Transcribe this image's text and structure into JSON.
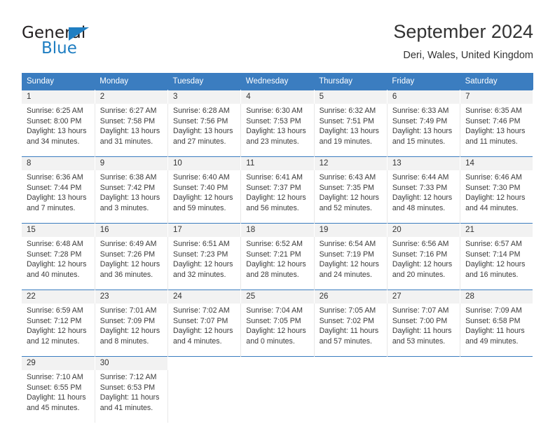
{
  "logo": {
    "word1": "General",
    "word2": "Blue",
    "triangle_color": "#1f7ec2",
    "text_color": "#231f20"
  },
  "header": {
    "title": "September 2024",
    "subtitle": "Deri, Wales, United Kingdom"
  },
  "theme": {
    "header_blue": "#3b7dc0",
    "daynum_band": "#f2f2f2",
    "text": "#333333"
  },
  "calendar": {
    "weekday_headers": [
      "Sunday",
      "Monday",
      "Tuesday",
      "Wednesday",
      "Thursday",
      "Friday",
      "Saturday"
    ],
    "labels": {
      "sunrise": "Sunrise:",
      "sunset": "Sunset:",
      "daylight": "Daylight:"
    },
    "weeks": [
      [
        {
          "day": "1",
          "sunrise": "Sunrise: 6:25 AM",
          "sunset": "Sunset: 8:00 PM",
          "daylight": "Daylight: 13 hours and 34 minutes."
        },
        {
          "day": "2",
          "sunrise": "Sunrise: 6:27 AM",
          "sunset": "Sunset: 7:58 PM",
          "daylight": "Daylight: 13 hours and 31 minutes."
        },
        {
          "day": "3",
          "sunrise": "Sunrise: 6:28 AM",
          "sunset": "Sunset: 7:56 PM",
          "daylight": "Daylight: 13 hours and 27 minutes."
        },
        {
          "day": "4",
          "sunrise": "Sunrise: 6:30 AM",
          "sunset": "Sunset: 7:53 PM",
          "daylight": "Daylight: 13 hours and 23 minutes."
        },
        {
          "day": "5",
          "sunrise": "Sunrise: 6:32 AM",
          "sunset": "Sunset: 7:51 PM",
          "daylight": "Daylight: 13 hours and 19 minutes."
        },
        {
          "day": "6",
          "sunrise": "Sunrise: 6:33 AM",
          "sunset": "Sunset: 7:49 PM",
          "daylight": "Daylight: 13 hours and 15 minutes."
        },
        {
          "day": "7",
          "sunrise": "Sunrise: 6:35 AM",
          "sunset": "Sunset: 7:46 PM",
          "daylight": "Daylight: 13 hours and 11 minutes."
        }
      ],
      [
        {
          "day": "8",
          "sunrise": "Sunrise: 6:36 AM",
          "sunset": "Sunset: 7:44 PM",
          "daylight": "Daylight: 13 hours and 7 minutes."
        },
        {
          "day": "9",
          "sunrise": "Sunrise: 6:38 AM",
          "sunset": "Sunset: 7:42 PM",
          "daylight": "Daylight: 13 hours and 3 minutes."
        },
        {
          "day": "10",
          "sunrise": "Sunrise: 6:40 AM",
          "sunset": "Sunset: 7:40 PM",
          "daylight": "Daylight: 12 hours and 59 minutes."
        },
        {
          "day": "11",
          "sunrise": "Sunrise: 6:41 AM",
          "sunset": "Sunset: 7:37 PM",
          "daylight": "Daylight: 12 hours and 56 minutes."
        },
        {
          "day": "12",
          "sunrise": "Sunrise: 6:43 AM",
          "sunset": "Sunset: 7:35 PM",
          "daylight": "Daylight: 12 hours and 52 minutes."
        },
        {
          "day": "13",
          "sunrise": "Sunrise: 6:44 AM",
          "sunset": "Sunset: 7:33 PM",
          "daylight": "Daylight: 12 hours and 48 minutes."
        },
        {
          "day": "14",
          "sunrise": "Sunrise: 6:46 AM",
          "sunset": "Sunset: 7:30 PM",
          "daylight": "Daylight: 12 hours and 44 minutes."
        }
      ],
      [
        {
          "day": "15",
          "sunrise": "Sunrise: 6:48 AM",
          "sunset": "Sunset: 7:28 PM",
          "daylight": "Daylight: 12 hours and 40 minutes."
        },
        {
          "day": "16",
          "sunrise": "Sunrise: 6:49 AM",
          "sunset": "Sunset: 7:26 PM",
          "daylight": "Daylight: 12 hours and 36 minutes."
        },
        {
          "day": "17",
          "sunrise": "Sunrise: 6:51 AM",
          "sunset": "Sunset: 7:23 PM",
          "daylight": "Daylight: 12 hours and 32 minutes."
        },
        {
          "day": "18",
          "sunrise": "Sunrise: 6:52 AM",
          "sunset": "Sunset: 7:21 PM",
          "daylight": "Daylight: 12 hours and 28 minutes."
        },
        {
          "day": "19",
          "sunrise": "Sunrise: 6:54 AM",
          "sunset": "Sunset: 7:19 PM",
          "daylight": "Daylight: 12 hours and 24 minutes."
        },
        {
          "day": "20",
          "sunrise": "Sunrise: 6:56 AM",
          "sunset": "Sunset: 7:16 PM",
          "daylight": "Daylight: 12 hours and 20 minutes."
        },
        {
          "day": "21",
          "sunrise": "Sunrise: 6:57 AM",
          "sunset": "Sunset: 7:14 PM",
          "daylight": "Daylight: 12 hours and 16 minutes."
        }
      ],
      [
        {
          "day": "22",
          "sunrise": "Sunrise: 6:59 AM",
          "sunset": "Sunset: 7:12 PM",
          "daylight": "Daylight: 12 hours and 12 minutes."
        },
        {
          "day": "23",
          "sunrise": "Sunrise: 7:01 AM",
          "sunset": "Sunset: 7:09 PM",
          "daylight": "Daylight: 12 hours and 8 minutes."
        },
        {
          "day": "24",
          "sunrise": "Sunrise: 7:02 AM",
          "sunset": "Sunset: 7:07 PM",
          "daylight": "Daylight: 12 hours and 4 minutes."
        },
        {
          "day": "25",
          "sunrise": "Sunrise: 7:04 AM",
          "sunset": "Sunset: 7:05 PM",
          "daylight": "Daylight: 12 hours and 0 minutes."
        },
        {
          "day": "26",
          "sunrise": "Sunrise: 7:05 AM",
          "sunset": "Sunset: 7:02 PM",
          "daylight": "Daylight: 11 hours and 57 minutes."
        },
        {
          "day": "27",
          "sunrise": "Sunrise: 7:07 AM",
          "sunset": "Sunset: 7:00 PM",
          "daylight": "Daylight: 11 hours and 53 minutes."
        },
        {
          "day": "28",
          "sunrise": "Sunrise: 7:09 AM",
          "sunset": "Sunset: 6:58 PM",
          "daylight": "Daylight: 11 hours and 49 minutes."
        }
      ],
      [
        {
          "day": "29",
          "sunrise": "Sunrise: 7:10 AM",
          "sunset": "Sunset: 6:55 PM",
          "daylight": "Daylight: 11 hours and 45 minutes."
        },
        {
          "day": "30",
          "sunrise": "Sunrise: 7:12 AM",
          "sunset": "Sunset: 6:53 PM",
          "daylight": "Daylight: 11 hours and 41 minutes."
        },
        {
          "day": "",
          "sunrise": "",
          "sunset": "",
          "daylight": ""
        },
        {
          "day": "",
          "sunrise": "",
          "sunset": "",
          "daylight": ""
        },
        {
          "day": "",
          "sunrise": "",
          "sunset": "",
          "daylight": ""
        },
        {
          "day": "",
          "sunrise": "",
          "sunset": "",
          "daylight": ""
        },
        {
          "day": "",
          "sunrise": "",
          "sunset": "",
          "daylight": ""
        }
      ]
    ]
  }
}
